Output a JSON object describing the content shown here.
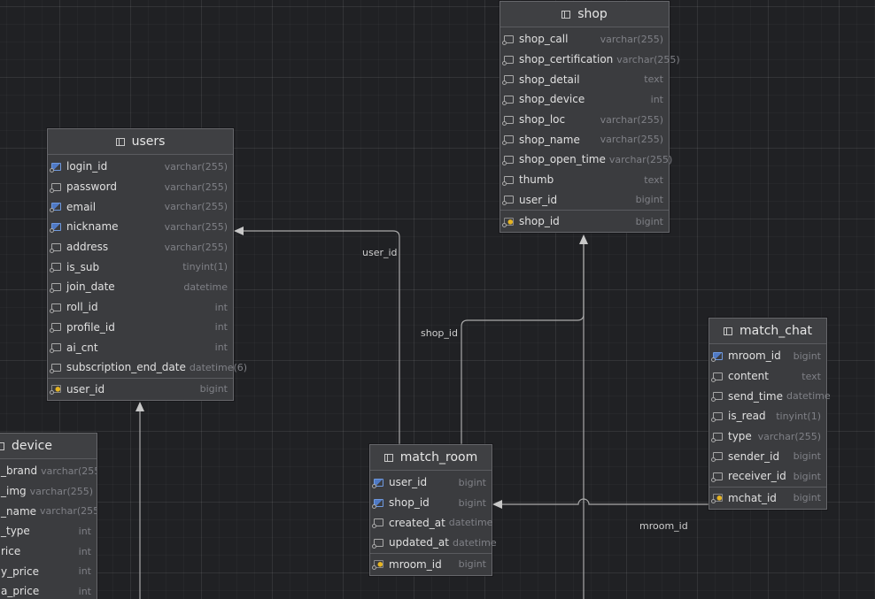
{
  "tables": {
    "shop": {
      "name": "shop",
      "columns": [
        {
          "name": "shop_call",
          "type": "varchar(255)"
        },
        {
          "name": "shop_certification",
          "type": "varchar(255)"
        },
        {
          "name": "shop_detail",
          "type": "text"
        },
        {
          "name": "shop_device",
          "type": "int"
        },
        {
          "name": "shop_loc",
          "type": "varchar(255)"
        },
        {
          "name": "shop_name",
          "type": "varchar(255)"
        },
        {
          "name": "shop_open_time",
          "type": "varchar(255)"
        },
        {
          "name": "thumb",
          "type": "text"
        },
        {
          "name": "user_id",
          "type": "bigint"
        }
      ],
      "pk": {
        "name": "shop_id",
        "type": "bigint"
      }
    },
    "users": {
      "name": "users",
      "columns": [
        {
          "name": "login_id",
          "type": "varchar(255)"
        },
        {
          "name": "password",
          "type": "varchar(255)"
        },
        {
          "name": "email",
          "type": "varchar(255)"
        },
        {
          "name": "nickname",
          "type": "varchar(255)"
        },
        {
          "name": "address",
          "type": "varchar(255)"
        },
        {
          "name": "is_sub",
          "type": "tinyint(1)"
        },
        {
          "name": "join_date",
          "type": "datetime"
        },
        {
          "name": "roll_id",
          "type": "int"
        },
        {
          "name": "profile_id",
          "type": "int"
        },
        {
          "name": "ai_cnt",
          "type": "int"
        },
        {
          "name": "subscription_end_date",
          "type": "datetime(6)"
        }
      ],
      "pk": {
        "name": "user_id",
        "type": "bigint"
      }
    },
    "match_chat": {
      "name": "match_chat",
      "columns": [
        {
          "name": "mroom_id",
          "type": "bigint"
        },
        {
          "name": "content",
          "type": "text"
        },
        {
          "name": "send_time",
          "type": "datetime"
        },
        {
          "name": "is_read",
          "type": "tinyint(1)"
        },
        {
          "name": "type",
          "type": "varchar(255)"
        },
        {
          "name": "sender_id",
          "type": "bigint"
        },
        {
          "name": "receiver_id",
          "type": "bigint"
        }
      ],
      "pk": {
        "name": "mchat_id",
        "type": "bigint"
      }
    },
    "match_room": {
      "name": "match_room",
      "columns": [
        {
          "name": "user_id",
          "type": "bigint"
        },
        {
          "name": "shop_id",
          "type": "bigint"
        },
        {
          "name": "created_at",
          "type": "datetime"
        },
        {
          "name": "updated_at",
          "type": "datetime"
        }
      ],
      "pk": {
        "name": "mroom_id",
        "type": "bigint"
      }
    },
    "device": {
      "name": "device",
      "columns": [
        {
          "name": "_brand",
          "type": "varchar(255)"
        },
        {
          "name": "_img",
          "type": "varchar(255)"
        },
        {
          "name": "_name",
          "type": "varchar(255)"
        },
        {
          "name": "_type",
          "type": "int"
        },
        {
          "name": "rice",
          "type": "int"
        },
        {
          "name": "y_price",
          "type": "int"
        },
        {
          "name": "a_price",
          "type": "int"
        }
      ]
    }
  },
  "edge_labels": {
    "user_id": "user_id",
    "shop_id": "shop_id",
    "mroom_id": "mroom_id"
  },
  "colors": {
    "background": "#202124",
    "table_body": "#3b3c3f",
    "edge": "#a9a9a9",
    "fk_icon": "#4f79c4",
    "pk_key": "#e6b422"
  }
}
